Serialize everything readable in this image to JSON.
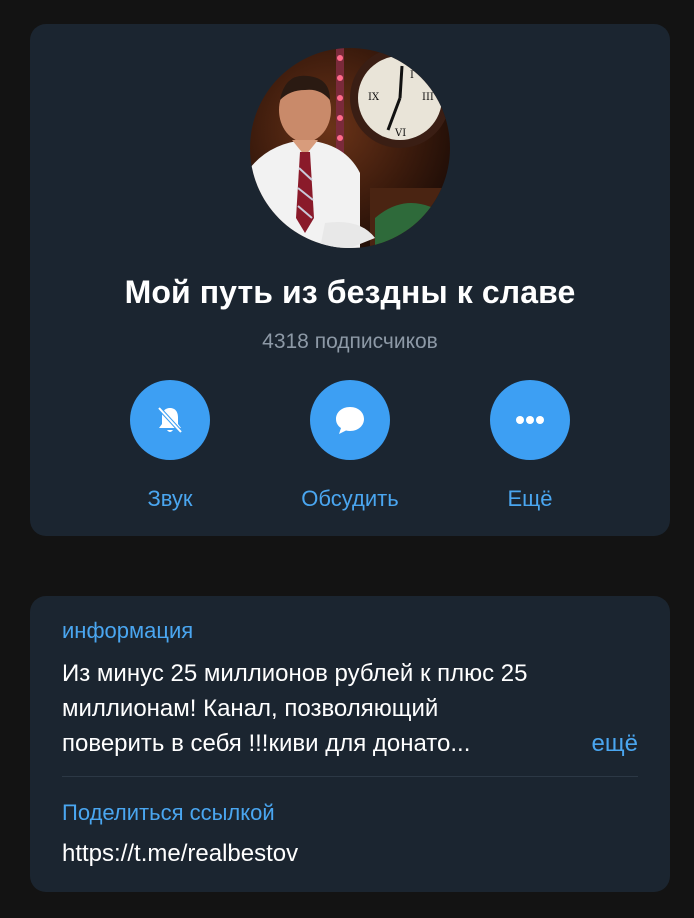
{
  "channel": {
    "title": "Мой путь из бездны к славе",
    "subscribers": "4318 подписчиков"
  },
  "actions": [
    {
      "label": "Звук",
      "icon": "bell-muted-icon"
    },
    {
      "label": "Обсудить",
      "icon": "chat-bubble-icon"
    },
    {
      "label": "Ещё",
      "icon": "more-dots-icon"
    }
  ],
  "info": {
    "section_label": "информация",
    "lines": [
      "Из минус 25 миллионов рублей к плюс 25",
      "миллионам! Канал, позволяющий",
      "поверить в себя !!!киви для донато..."
    ],
    "more_label": "ещё"
  },
  "share": {
    "label": "Поделиться ссылкой",
    "link": "https://t.me/realbestov"
  },
  "colors": {
    "background": "#131313",
    "card": "#1b2530",
    "accent": "#3d9ff3",
    "link": "#4aa6f0",
    "secondary_text": "#8d99a6"
  }
}
